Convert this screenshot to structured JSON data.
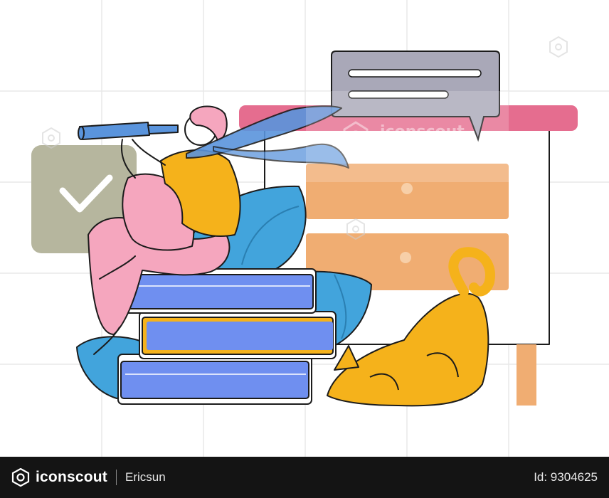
{
  "illustration": {
    "theme_colors": {
      "grid": "#e6e6e6",
      "check_card": "#b6b69e",
      "chat_bubble": "#a9a8b8",
      "dresser_top": "#e56d8f",
      "drawers": "#f0ad72",
      "books_blue": "#6f8ff0",
      "books_yellow": "#f5b21b",
      "leaves": "#42a4dc",
      "pants": "#f5a6be",
      "shirt": "#f5b21b",
      "hair": "#f5a6be",
      "scarf": "#5a94dc",
      "cat": "#f5b21b",
      "telescope": "#5a94dc",
      "outline": "#1b1b1b"
    },
    "icons": [
      "check-icon",
      "telescope-icon",
      "cat-icon",
      "books-icon",
      "dresser-icon",
      "chat-bubble-icon"
    ]
  },
  "watermark": {
    "brand": "iconscout",
    "author": "Ericsun"
  },
  "footer": {
    "brand": "iconscout",
    "author": "Ericsun",
    "asset_id": "Id: 9304625"
  }
}
